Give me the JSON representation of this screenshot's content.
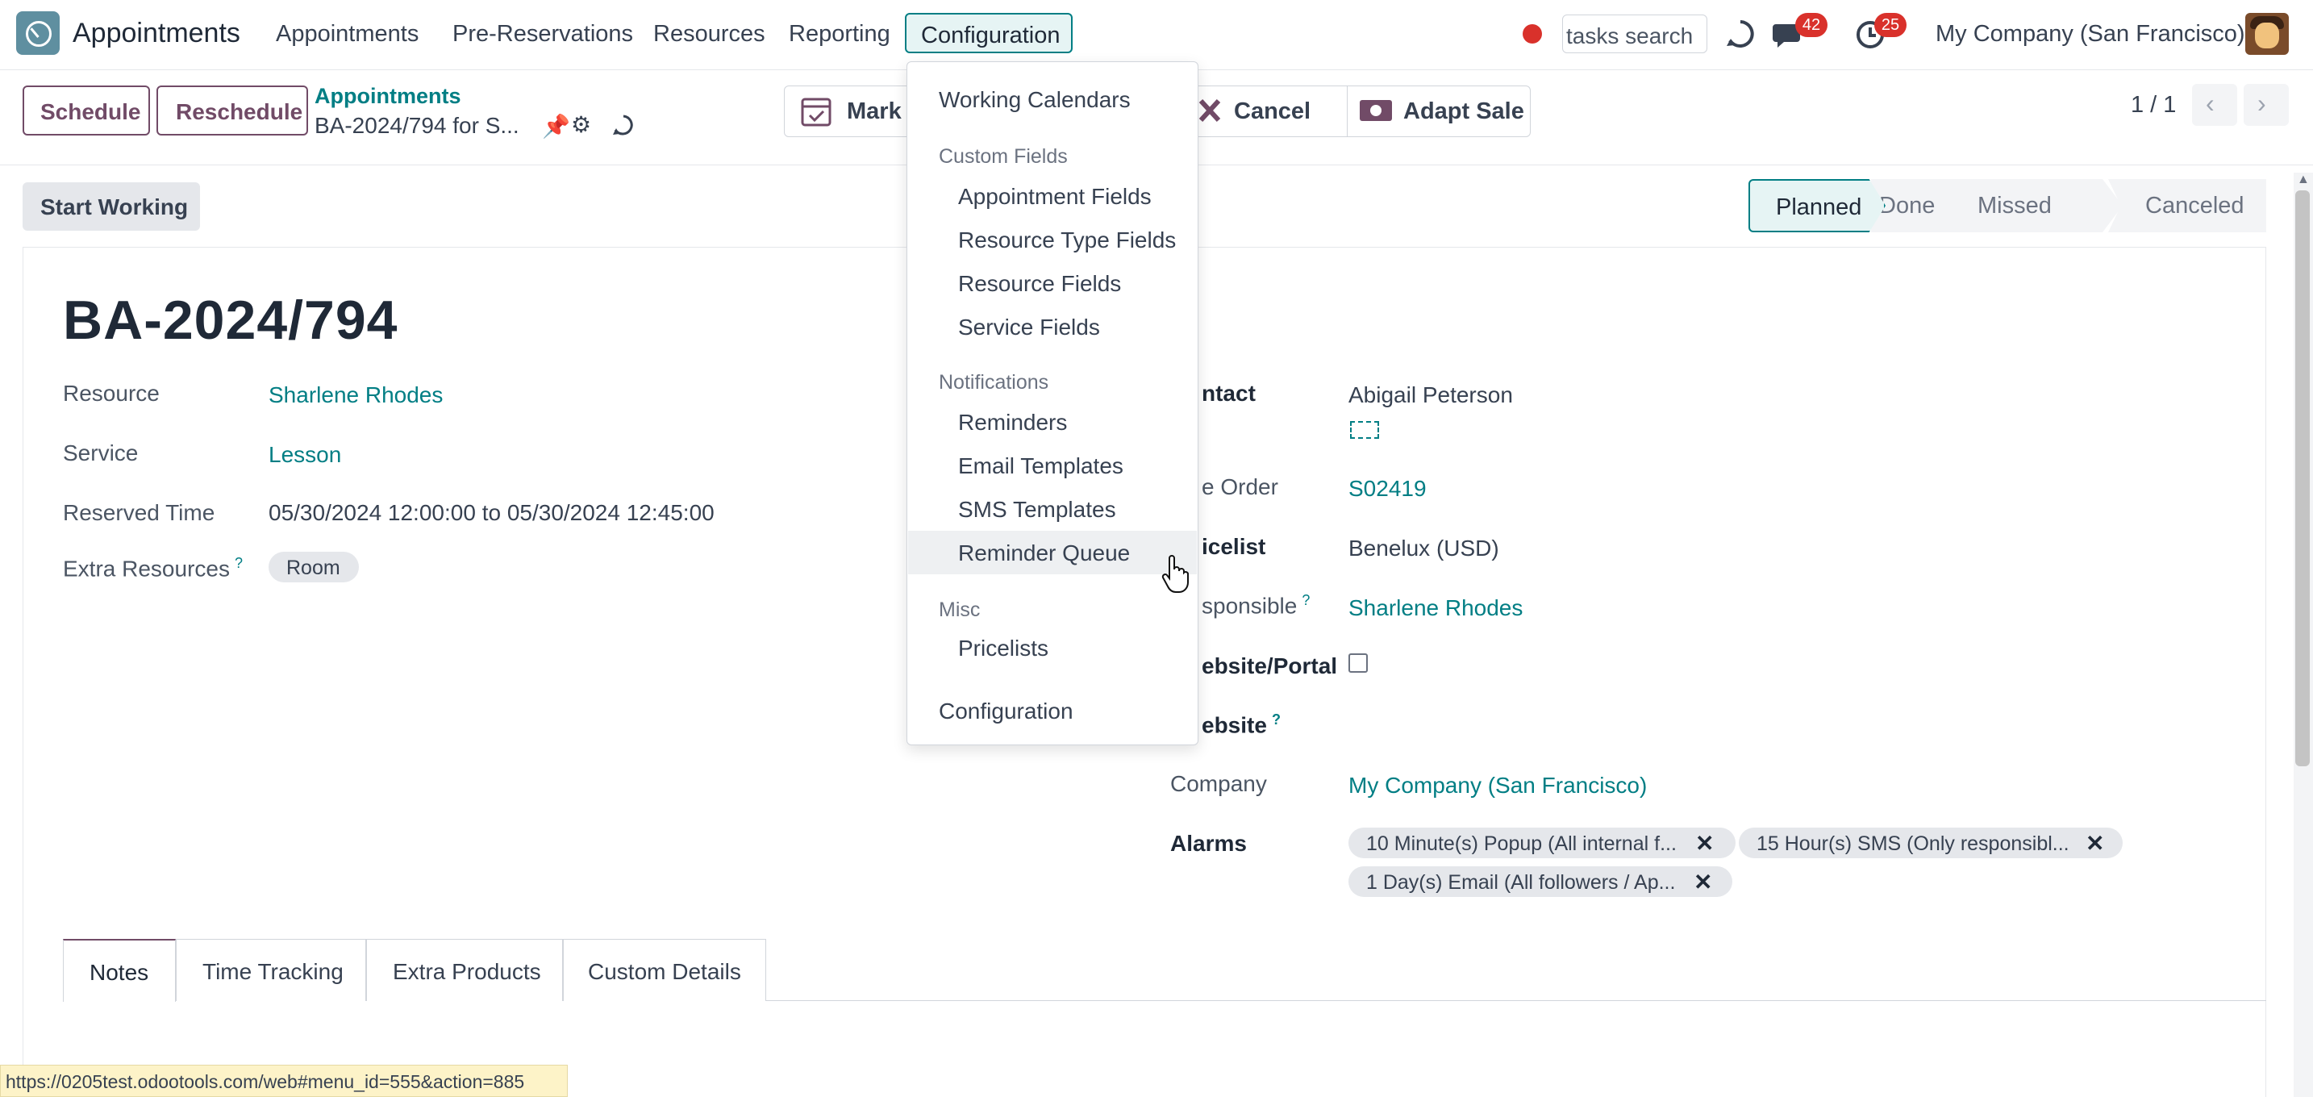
{
  "topnav": {
    "app_name": "Appointments",
    "menu": [
      "Appointments",
      "Pre-Reservations",
      "Resources",
      "Reporting",
      "Configuration"
    ],
    "search_placeholder": "tasks search",
    "messages_badge": "42",
    "activities_badge": "25",
    "company": "My Company (San Francisco)"
  },
  "control_panel": {
    "schedule_label": "Schedule",
    "reschedule_label": "Reschedule",
    "breadcrumb": "Appointments",
    "record": "BA-2024/794 for S...",
    "mark_label": "Mark",
    "cancel_label": "Cancel",
    "adapt_sale_label": "Adapt Sale",
    "pager": "1 / 1"
  },
  "actions": {
    "start_working": "Start Working"
  },
  "statusbar": [
    "Planned",
    "Done",
    "Missed",
    "Canceled"
  ],
  "form": {
    "name": "BA-2024/794",
    "left": {
      "resource_label": "Resource",
      "resource": "Sharlene Rhodes",
      "service_label": "Service",
      "service": "Lesson",
      "reserved_time_label": "Reserved Time",
      "reserved_time": "05/30/2024 12:00:00 to 05/30/2024 12:45:00",
      "extra_resources_label": "Extra Resources",
      "extra_resource_tag": "Room"
    },
    "right": {
      "contact_label": "ntact",
      "contact": "Abigail Peterson",
      "sale_order_label": "e Order",
      "sale_order": "S02419",
      "pricelist_label": "icelist",
      "pricelist": "Benelux (USD)",
      "responsible_label": "sponsible",
      "responsible": "Sharlene Rhodes",
      "portal_label": "ebsite/Portal",
      "website_label": "ebsite",
      "company_label": "Company",
      "company": "My Company (San Francisco)",
      "alarms_label": "Alarms",
      "alarms": [
        "10 Minute(s) Popup (All internal f...",
        "15 Hour(s) SMS (Only responsibl...",
        "1 Day(s) Email (All followers / Ap..."
      ]
    }
  },
  "tabs": [
    "Notes",
    "Time Tracking",
    "Extra Products",
    "Custom Details"
  ],
  "dropdown": {
    "working_calendars": "Working Calendars",
    "custom_fields_header": "Custom Fields",
    "appointment_fields": "Appointment Fields",
    "resource_type_fields": "Resource Type Fields",
    "resource_fields": "Resource Fields",
    "service_fields": "Service Fields",
    "notifications_header": "Notifications",
    "reminders": "Reminders",
    "email_templates": "Email Templates",
    "sms_templates": "SMS Templates",
    "reminder_queue": "Reminder Queue",
    "misc_header": "Misc",
    "pricelists": "Pricelists",
    "configuration": "Configuration"
  },
  "status_url": "https://0205test.odootools.com/web#menu_id=555&action=885",
  "colors": {
    "primary": "#714b67",
    "link": "#017e84",
    "badge": "#d9312b"
  }
}
